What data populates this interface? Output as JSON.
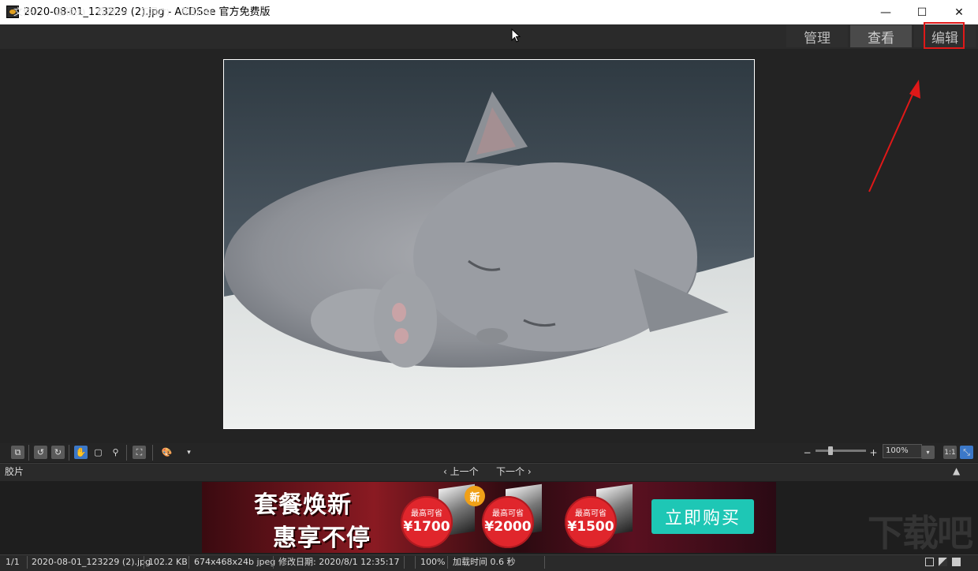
{
  "window": {
    "title": "2020-08-01_123229 (2).jpg - ACDSee 官方免费版",
    "minimize": "—",
    "maximize": "☐",
    "close": "✕"
  },
  "menu": {
    "items": [
      {
        "label": "文件",
        "acc": "(F)"
      },
      {
        "label": "编辑",
        "acc": "(E)"
      },
      {
        "label": "视图",
        "acc": "(V)"
      },
      {
        "label": "工具",
        "acc": "(T)"
      },
      {
        "label": "帮助",
        "acc": "(H)"
      }
    ]
  },
  "modes": {
    "manage": "管理",
    "view": "查看",
    "edit": "编辑"
  },
  "toolbar": {
    "zoom_value": "100%",
    "actual_size": "1:1"
  },
  "filmstrip": {
    "title": "胶片",
    "prev": "‹ 上一个",
    "next": "下一个 ›"
  },
  "banner": {
    "headline1": "套餐焕新",
    "headline2": "惠享不停",
    "new_badge": "新",
    "offers": [
      {
        "label": "最高可省",
        "amount": "¥1700"
      },
      {
        "label": "最高可省",
        "amount": "¥2000"
      },
      {
        "label": "最高可省",
        "amount": "¥1500"
      }
    ],
    "buy_label": "立即购买"
  },
  "status": {
    "index": "1/1",
    "filename": "2020-08-01_123229 (2).jpg",
    "filesize": "102.2 KB",
    "dimensions": "674x468x24b jpeg",
    "modified": "修改日期: 2020/8/1 12:35:17",
    "zoom": "100%",
    "load_time": "加载时间 0.6 秒"
  },
  "colors": {
    "accent_annotation": "#e01818",
    "active_mode_bg": "#444444",
    "buy_button": "#1ec7b5"
  },
  "watermark": "下载吧"
}
